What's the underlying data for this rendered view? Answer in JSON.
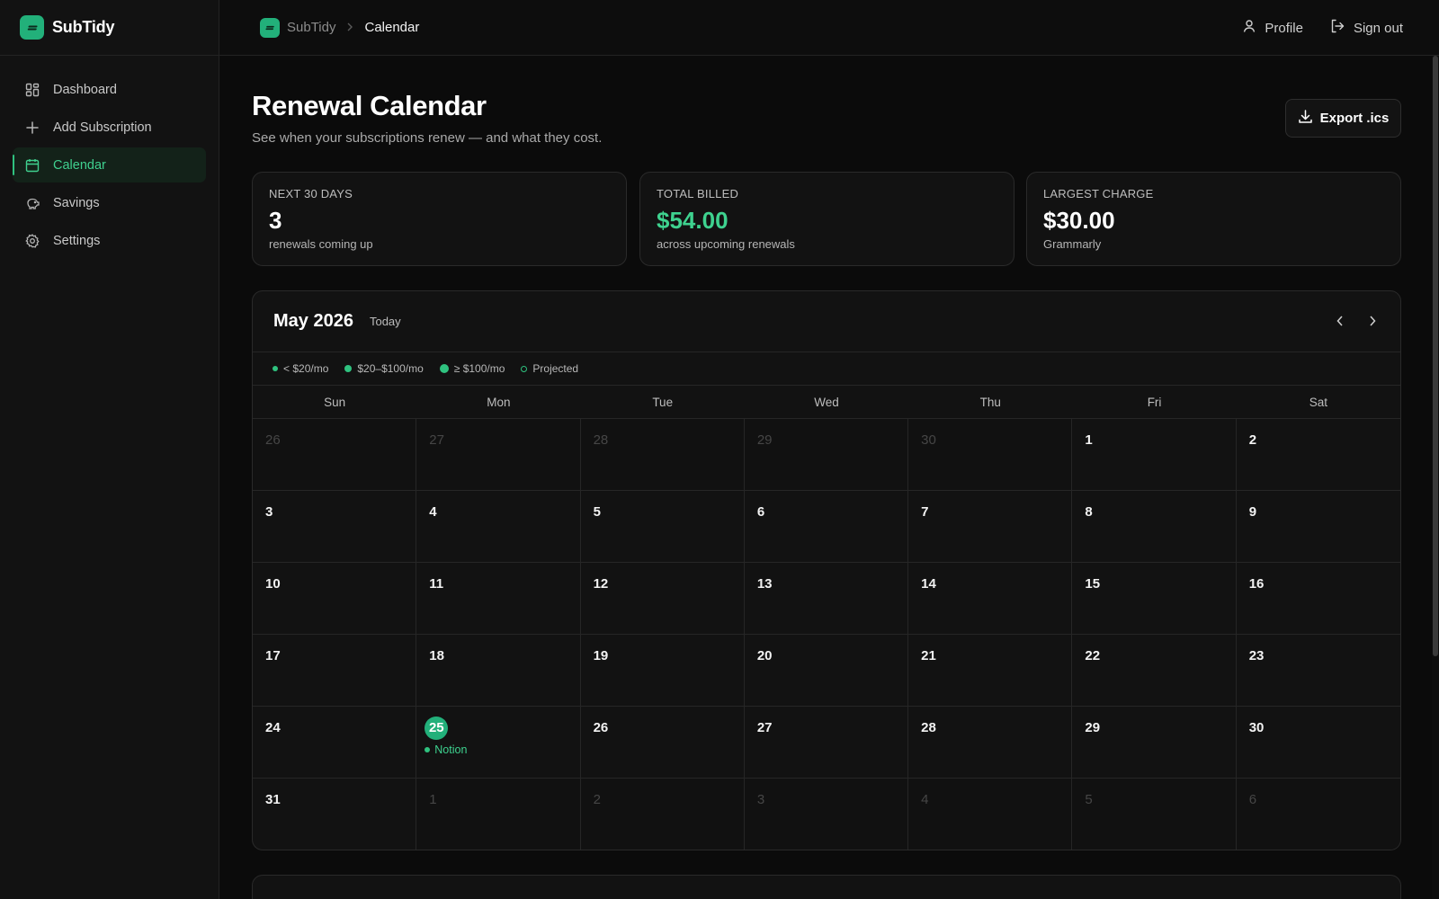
{
  "app": {
    "name": "SubTidy"
  },
  "sidebar": {
    "items": [
      {
        "label": "Dashboard",
        "icon": "dashboard-icon"
      },
      {
        "label": "Add Subscription",
        "icon": "plus-icon"
      },
      {
        "label": "Calendar",
        "icon": "calendar-icon",
        "active": true
      },
      {
        "label": "Savings",
        "icon": "piggy-bank-icon"
      },
      {
        "label": "Settings",
        "icon": "gear-icon"
      }
    ]
  },
  "topbar": {
    "breadcrumb": {
      "app": "SubTidy",
      "current": "Calendar"
    },
    "profile_label": "Profile",
    "signout_label": "Sign out"
  },
  "page": {
    "title": "Renewal Calendar",
    "subtitle": "See when your subscriptions renew — and what they cost.",
    "export_label": "Export .ics"
  },
  "stats": [
    {
      "label": "NEXT 30 DAYS",
      "value": "3",
      "desc": "renewals coming up"
    },
    {
      "label": "TOTAL BILLED",
      "value": "$54.00",
      "desc": "across upcoming renewals"
    },
    {
      "label": "LARGEST CHARGE",
      "value": "$30.00",
      "desc": "Grammarly"
    }
  ],
  "calendar": {
    "month_label": "May 2026",
    "today_label": "Today",
    "legend": [
      {
        "label": "< $20/mo",
        "size": "s"
      },
      {
        "label": "$20–$100/mo",
        "size": "m"
      },
      {
        "label": "≥ $100/mo",
        "size": "l"
      },
      {
        "label": "Projected",
        "size": "proj"
      }
    ],
    "weekdays": [
      "Sun",
      "Mon",
      "Tue",
      "Wed",
      "Thu",
      "Fri",
      "Sat"
    ],
    "days": [
      {
        "n": "26",
        "muted": true
      },
      {
        "n": "27",
        "muted": true
      },
      {
        "n": "28",
        "muted": true
      },
      {
        "n": "29",
        "muted": true
      },
      {
        "n": "30",
        "muted": true
      },
      {
        "n": "1"
      },
      {
        "n": "2"
      },
      {
        "n": "3"
      },
      {
        "n": "4"
      },
      {
        "n": "5"
      },
      {
        "n": "6"
      },
      {
        "n": "7"
      },
      {
        "n": "8"
      },
      {
        "n": "9"
      },
      {
        "n": "10"
      },
      {
        "n": "11"
      },
      {
        "n": "12"
      },
      {
        "n": "13"
      },
      {
        "n": "14"
      },
      {
        "n": "15"
      },
      {
        "n": "16"
      },
      {
        "n": "17"
      },
      {
        "n": "18"
      },
      {
        "n": "19"
      },
      {
        "n": "20"
      },
      {
        "n": "21"
      },
      {
        "n": "22"
      },
      {
        "n": "23"
      },
      {
        "n": "24"
      },
      {
        "n": "25",
        "today": true,
        "event": "Notion"
      },
      {
        "n": "26"
      },
      {
        "n": "27"
      },
      {
        "n": "28"
      },
      {
        "n": "29"
      },
      {
        "n": "30"
      },
      {
        "n": "31"
      },
      {
        "n": "1",
        "muted": true
      },
      {
        "n": "2",
        "muted": true
      },
      {
        "n": "3",
        "muted": true
      },
      {
        "n": "4",
        "muted": true
      },
      {
        "n": "5",
        "muted": true
      },
      {
        "n": "6",
        "muted": true
      }
    ]
  },
  "colors": {
    "accent": "#22b07a",
    "accent_text": "#3ed28f",
    "background": "#0b0b0b",
    "surface": "#121212"
  }
}
